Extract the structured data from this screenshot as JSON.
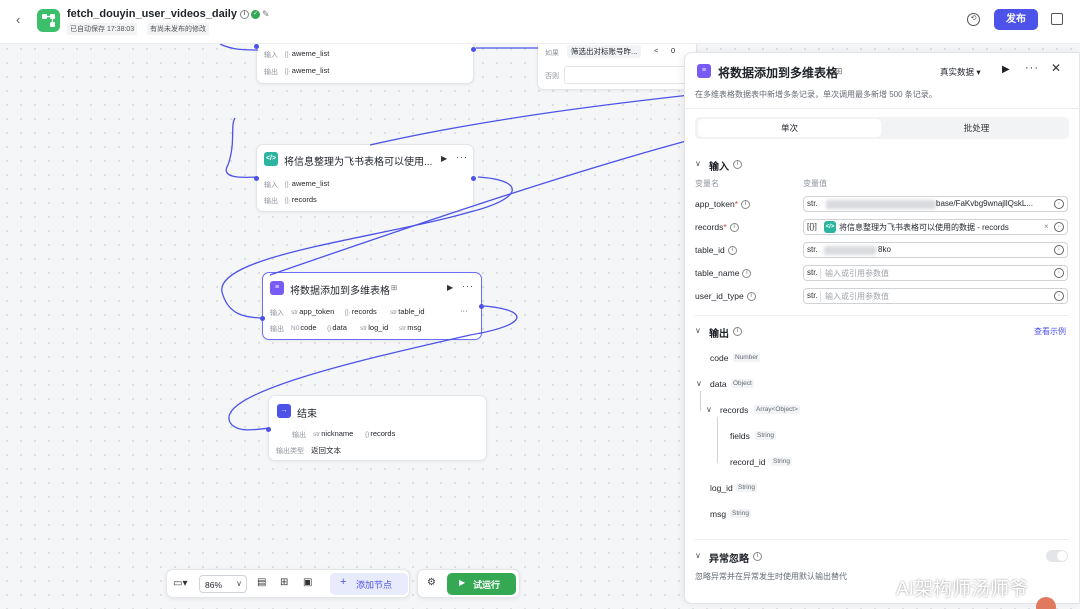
{
  "header": {
    "back": "‹",
    "title": "fetch_douyin_user_videos_daily",
    "save_status": "已自动保存 17:38:03",
    "unpublished": "有尚未发布的修改",
    "publish_label": "发布"
  },
  "nodes": {
    "top_left": {
      "in_label": "输入",
      "in_value": "aweme_list",
      "out_label": "输出",
      "out_value": "aweme_list"
    },
    "cond": {
      "if_label": "如果",
      "filter": "筛选出对标账号昨...",
      "op": "<",
      "val": "0",
      "else_label": "否则"
    },
    "code": {
      "title": "将信息整理为飞书表格可以使用...",
      "in_label": "输入",
      "in_value": "aweme_list",
      "out_label": "输出",
      "out_value": "records"
    },
    "table": {
      "title": "将数据添加到多维表格",
      "in_label": "输入",
      "in1": "app_token",
      "in2": "records",
      "in3": "table_id",
      "out_label": "输出",
      "out1": "code",
      "out2": "data",
      "out3": "log_id",
      "out4": "msg"
    },
    "end": {
      "title": "结束",
      "out_label": "输出",
      "out1": "nickname",
      "out2": "records",
      "type_label": "输出类型",
      "type_value": "返回文本"
    },
    "type_tags": {
      "arr": "[]·",
      "str": "str",
      "num": "N0",
      "obj": "{}"
    }
  },
  "panel": {
    "title": "将数据添加到多维表格",
    "mode": "真实数据",
    "desc": "在多维表格数据表中新增多条记录，单次调用最多新增 500 条记录。",
    "tab_single": "单次",
    "tab_batch": "批处理",
    "input_section": "输入",
    "col_name": "变量名",
    "col_value": "变量值",
    "inputs": [
      {
        "name": "app_token",
        "required": "*",
        "prefix": "str.",
        "value": "base/FaKvbg9wnajllQskL..."
      },
      {
        "name": "records",
        "required": "*",
        "prefix": "[{}]",
        "value": "将信息整理为飞书表格可以使用的数据 - records"
      },
      {
        "name": "table_id",
        "required": "",
        "prefix": "str.",
        "value": "8ko"
      },
      {
        "name": "table_name",
        "required": "",
        "prefix": "str.",
        "placeholder": "输入或引用参数值"
      },
      {
        "name": "user_id_type",
        "required": "",
        "prefix": "str.",
        "placeholder": "输入或引用参数值"
      }
    ],
    "output_section": "输出",
    "view_example": "查看示例",
    "outputs": [
      {
        "name": "code",
        "type": "Number"
      },
      {
        "name": "data",
        "type": "Object"
      },
      {
        "name": "records",
        "type": "Array<Object>"
      },
      {
        "name": "fields",
        "type": "String"
      },
      {
        "name": "record_id",
        "type": "String"
      },
      {
        "name": "log_id",
        "type": "String"
      },
      {
        "name": "msg",
        "type": "String"
      }
    ],
    "error_section": "异常忽略",
    "error_desc": "忽略异常并在异常发生时使用默认输出替代"
  },
  "toolbar": {
    "zoom": "86%",
    "add_node": "添加节点",
    "test_run": "试运行"
  },
  "watermark": "AI架构师汤师爷",
  "colors": {
    "accent": "#4d53e8",
    "green": "#34a853",
    "code_icon": "#2bb5a0",
    "table_icon": "#7a5af5"
  }
}
